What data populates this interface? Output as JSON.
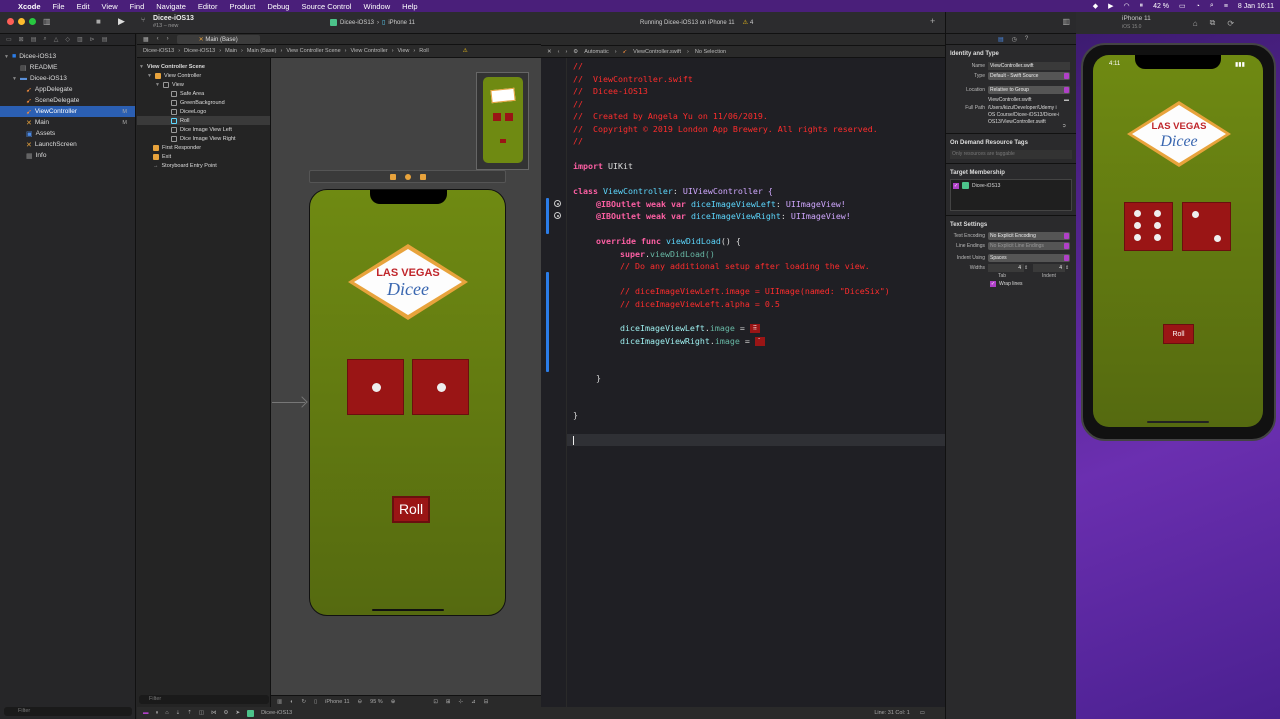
{
  "menubar": {
    "items": [
      "Xcode",
      "File",
      "Edit",
      "View",
      "Find",
      "Navigate",
      "Editor",
      "Product",
      "Debug",
      "Source Control",
      "Window",
      "Help"
    ],
    "battery": "42 %",
    "datetime": "8 Jan  16:11"
  },
  "toolbar": {
    "project": "Dicee-iOS13",
    "branch": "#13 – new",
    "scheme": "Dicee-iOS13",
    "device": "iPhone 11",
    "status": "Running Dicee-iOS13 on iPhone 11",
    "warnings": "4"
  },
  "navigator": {
    "items": [
      {
        "label": "Dicee-iOS13",
        "badge": ""
      },
      {
        "label": "README",
        "badge": ""
      },
      {
        "label": "Dicee-iOS13",
        "badge": ""
      },
      {
        "label": "AppDelegate",
        "badge": ""
      },
      {
        "label": "SceneDelegate",
        "badge": ""
      },
      {
        "label": "ViewController",
        "badge": "M"
      },
      {
        "label": "Main",
        "badge": "M"
      },
      {
        "label": "Assets",
        "badge": ""
      },
      {
        "label": "LaunchScreen",
        "badge": ""
      },
      {
        "label": "Info",
        "badge": ""
      }
    ],
    "filter": "Filter"
  },
  "editor_tab": "Main (Base)",
  "ib_breadcrumb": [
    "Dicee-iOS13",
    "Dicee-iOS13",
    "Main",
    "Main (Base)",
    "View Controller Scene",
    "View Controller",
    "View",
    "Roll"
  ],
  "outline": {
    "items": [
      "View Controller Scene",
      "View Controller",
      "View",
      "Safe Area",
      "GreenBackground",
      "DiceeLogo",
      "Roll",
      "Dice Image View Left",
      "Dice Image View Right",
      "First Responder",
      "Exit",
      "Storyboard Entry Point"
    ],
    "filter": "Filter"
  },
  "ib": {
    "logo_top": "LAS VEGAS",
    "logo_bottom": "Dicee",
    "roll": "Roll",
    "device": "iPhone 11",
    "zoom": "95 %"
  },
  "code_header": {
    "mode": "Automatic",
    "file": "ViewController.swift",
    "selection": "No Selection"
  },
  "code": {
    "c1": "//",
    "c2": "//  ViewController.swift",
    "c3": "//  Dicee-iOS13",
    "c4": "//",
    "c5": "//  Created by Angela Yu on 11/06/2019.",
    "c6": "//  Copyright © 2019 London App Brewery. All rights reserved.",
    "c7": "//",
    "import_kw": "import",
    "import_mod": "UIKit",
    "class_kw": "class",
    "class_name": "ViewController",
    "class_super": "UIViewController {",
    "outlet": "@IBOutlet",
    "weak_var": "weak var",
    "left_name": "diceImageViewLeft",
    "right_name": "diceImageViewRight",
    "uiimageview": "UIImageView!",
    "override": "override func",
    "vdl": "viewDidLoad",
    "vdl_paren": "() {",
    "super_kw": "super",
    "super_call": "viewDidLoad()",
    "cm_setup": "// Do any additional setup after loading the view.",
    "cm_img": "// diceImageViewLeft.image = UIImage(named: \"DiceSix\")",
    "cm_alpha": "// diceImageViewLeft.alpha = 0.5",
    "left_assign": "diceImageViewLeft",
    "right_assign": "diceImageViewRight",
    "image_prop": "image",
    "eq": " = ",
    "close_fn": "}",
    "close_cls": "}"
  },
  "code_status": "Line: 31  Col: 1",
  "debug_target": "Dicee-iOS13",
  "inspector": {
    "identity_title": "Identity and Type",
    "name_label": "Name",
    "name_value": "ViewController.swift",
    "type_label": "Type",
    "type_value": "Default - Swift Source",
    "location_label": "Location",
    "location_value": "Relative to Group",
    "location_file": "ViewController.swift",
    "fullpath_label": "Full Path",
    "fullpath_value": "/Users/kizu/Developer/Udemy iOS Course/Dicee-iOS13/Dicee-iOS13/ViewController.swift",
    "odr_title": "On Demand Resource Tags",
    "odr_placeholder": "Only resources are taggable",
    "target_title": "Target Membership",
    "target_name": "Dicee-iOS13",
    "text_title": "Text Settings",
    "encoding_label": "Text Encoding",
    "encoding_value": "No Explicit Encoding",
    "endings_label": "Line Endings",
    "endings_value": "No Explicit Line Endings",
    "indent_label": "Indent Using",
    "indent_value": "Spaces",
    "widths_label": "Widths",
    "tab_w": "4",
    "indent_w": "4",
    "tab_lbl": "Tab",
    "indent_lbl": "Indent",
    "wrap": "Wrap lines"
  },
  "simulator": {
    "device": "iPhone 11",
    "os": "iOS 15.0",
    "time": "4:11",
    "logo_top": "LAS VEGAS",
    "logo_bottom": "Dicee",
    "roll": "Roll"
  }
}
